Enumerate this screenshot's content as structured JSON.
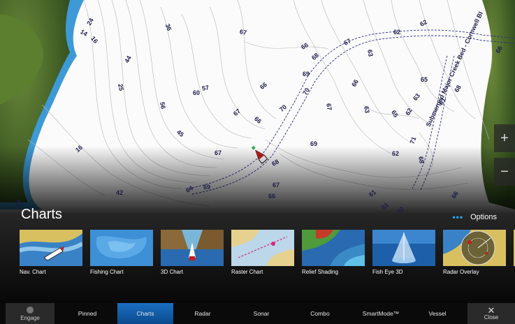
{
  "map": {
    "depth_labels": [
      "24",
      "36",
      "14",
      "16",
      "44",
      "67",
      "62",
      "62",
      "66",
      "68",
      "67",
      "63",
      "66",
      "69",
      "25",
      "57",
      "60",
      "56",
      "66",
      "70",
      "66",
      "65",
      "63",
      "67",
      "67",
      "63",
      "65",
      "62",
      "66",
      "45",
      "70",
      "61",
      "68",
      "16",
      "67",
      "69",
      "62",
      "68",
      "71",
      "42",
      "69",
      "64",
      "67",
      "61",
      "66",
      "43",
      "68",
      "66",
      "61",
      "62"
    ],
    "channel_label": "Submerged Major Creek Bed - Cornwell Bl",
    "zoom_in": "+",
    "zoom_out": "−"
  },
  "panel": {
    "title": "Charts",
    "options_label": "Options",
    "options_icon": "ellipsis-icon",
    "tiles": [
      {
        "label": "Nav. Chart"
      },
      {
        "label": "Fishing Chart"
      },
      {
        "label": "3D Chart"
      },
      {
        "label": "Raster Chart"
      },
      {
        "label": "Relief Shading"
      },
      {
        "label": "Fish Eye 3D"
      },
      {
        "label": "Radar Overlay"
      }
    ]
  },
  "bottom_bar": {
    "engage_label": "Engage",
    "tabs": [
      "Pinned",
      "Charts",
      "Radar",
      "Sonar",
      "Combo",
      "SmartMode™",
      "Vessel"
    ],
    "active_tab": "Charts",
    "close_label": "Close"
  },
  "colors": {
    "accent": "#1b6ec2",
    "depth_text": "#1c1d4a",
    "land": "#4a6a2a",
    "shallow": "#3d9ad6"
  }
}
